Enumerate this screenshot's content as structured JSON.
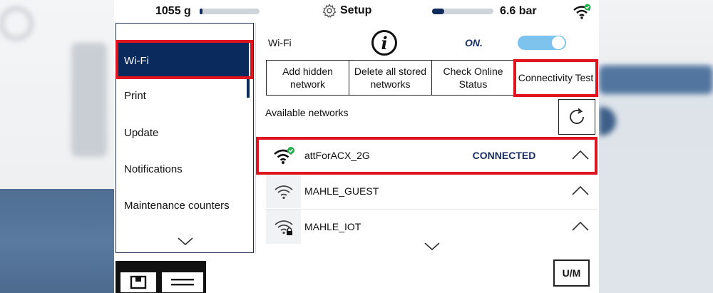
{
  "topbar": {
    "weight": "1055 g",
    "weight_level": 0.05,
    "title": "Setup",
    "pressure": "6.6 bar",
    "pressure_level": 0.2
  },
  "menu": {
    "items": [
      {
        "label": "Wi-Fi",
        "active": true
      },
      {
        "label": "Print",
        "active": false
      },
      {
        "label": "Update",
        "active": false
      },
      {
        "label": "Notifications",
        "active": false
      },
      {
        "label": "Maintenance counters",
        "active": false
      },
      {
        "label": "",
        "active": false
      }
    ]
  },
  "wifi": {
    "label": "Wi-Fi",
    "state": "ON.",
    "enabled": true
  },
  "actions": {
    "add_hidden": "Add hidden network",
    "delete_all": "Delete all stored networks",
    "check_online": "Check Online Status",
    "connectivity_test": "Connectivity Test"
  },
  "networks_label": "Available networks",
  "networks": [
    {
      "ssid": "attForACX_2G",
      "status": "CONNECTED",
      "secured": false,
      "connected": true
    },
    {
      "ssid": "MAHLE_GUEST",
      "status": "",
      "secured": false,
      "connected": false
    },
    {
      "ssid": "MAHLE_IOT",
      "status": "",
      "secured": true,
      "connected": false
    }
  ],
  "bottom": {
    "um_label": "U/M"
  },
  "colors": {
    "accent": "#0a2a5e",
    "highlight": "#e0141e",
    "toggle": "#7ec3ee",
    "connected_badge": "#22b14c"
  },
  "icons": [
    "settings-gear-icon",
    "wifi-connected-icon",
    "info-icon",
    "refresh-icon",
    "wifi-icon",
    "wifi-lock-icon",
    "chevron-up-icon",
    "chevron-down-icon",
    "save-icon",
    "menu-icon"
  ]
}
